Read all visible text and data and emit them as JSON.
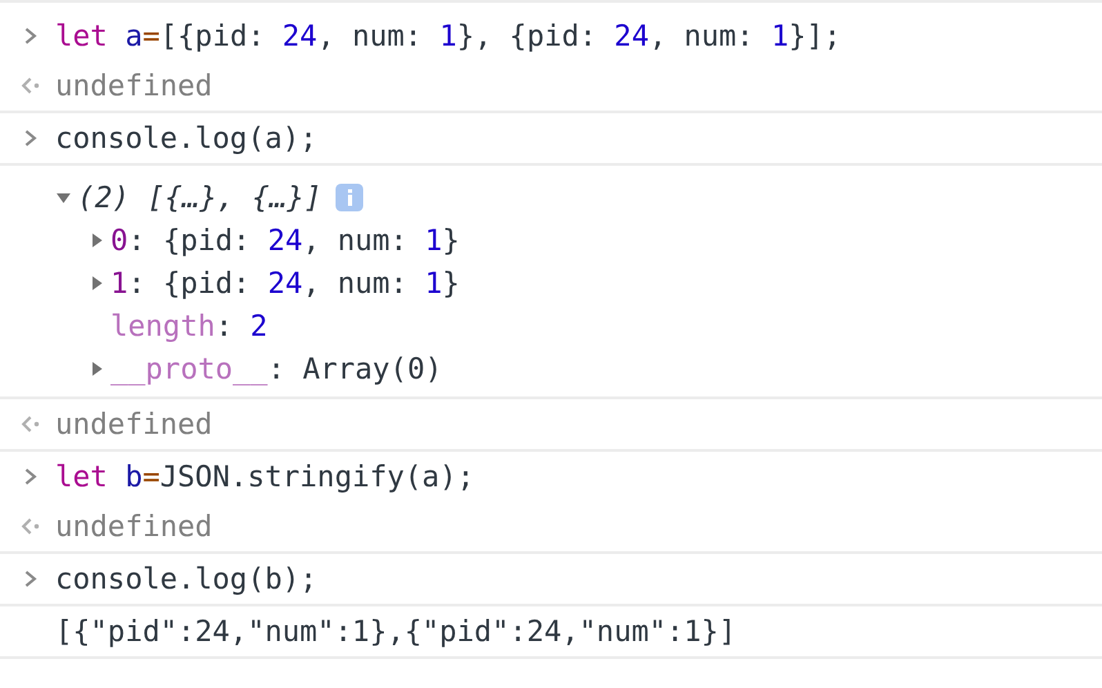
{
  "console": {
    "entries": [
      {
        "kind": "input",
        "tokens": [
          {
            "kind": "keyword",
            "text": "let "
          },
          {
            "kind": "variable",
            "text": "a"
          },
          {
            "kind": "operator",
            "text": "="
          },
          {
            "kind": "plain",
            "text": "[{pid: "
          },
          {
            "kind": "number",
            "text": "24"
          },
          {
            "kind": "plain",
            "text": ", num: "
          },
          {
            "kind": "number",
            "text": "1"
          },
          {
            "kind": "plain",
            "text": "}, {pid: "
          },
          {
            "kind": "number",
            "text": "24"
          },
          {
            "kind": "plain",
            "text": ", num: "
          },
          {
            "kind": "number",
            "text": "1"
          },
          {
            "kind": "plain",
            "text": "}];"
          }
        ]
      },
      {
        "kind": "result",
        "text": "undefined"
      },
      {
        "kind": "input",
        "tokens": [
          {
            "kind": "plain",
            "text": "console.log(a);"
          }
        ]
      },
      {
        "kind": "tree",
        "summary": "(2) [{…}, {…}]",
        "expanded": true,
        "children": [
          {
            "key": "0",
            "enumerable": true,
            "expanded": false,
            "value": [
              {
                "kind": "plain",
                "text": ": {pid: "
              },
              {
                "kind": "number",
                "text": "24"
              },
              {
                "kind": "plain",
                "text": ", num: "
              },
              {
                "kind": "number",
                "text": "1"
              },
              {
                "kind": "plain",
                "text": "}"
              }
            ]
          },
          {
            "key": "1",
            "enumerable": true,
            "expanded": false,
            "value": [
              {
                "kind": "plain",
                "text": ": {pid: "
              },
              {
                "kind": "number",
                "text": "24"
              },
              {
                "kind": "plain",
                "text": ", num: "
              },
              {
                "kind": "number",
                "text": "1"
              },
              {
                "kind": "plain",
                "text": "}"
              }
            ]
          },
          {
            "key": "length",
            "enumerable": false,
            "value": [
              {
                "kind": "plain",
                "text": ": "
              },
              {
                "kind": "number",
                "text": "2"
              }
            ]
          },
          {
            "key": "__proto__",
            "enumerable": false,
            "expanded": false,
            "value": [
              {
                "kind": "plain",
                "text": ": Array(0)"
              }
            ]
          }
        ]
      },
      {
        "kind": "result",
        "text": "undefined"
      },
      {
        "kind": "input",
        "tokens": [
          {
            "kind": "keyword",
            "text": "let "
          },
          {
            "kind": "variable",
            "text": "b"
          },
          {
            "kind": "operator",
            "text": "="
          },
          {
            "kind": "plain",
            "text": "JSON.stringify(a);"
          }
        ]
      },
      {
        "kind": "result",
        "text": "undefined"
      },
      {
        "kind": "input",
        "tokens": [
          {
            "kind": "plain",
            "text": "console.log(b);"
          }
        ]
      },
      {
        "kind": "log",
        "text": "[{\"pid\":24,\"num\":1},{\"pid\":24,\"num\":1}]"
      }
    ]
  }
}
